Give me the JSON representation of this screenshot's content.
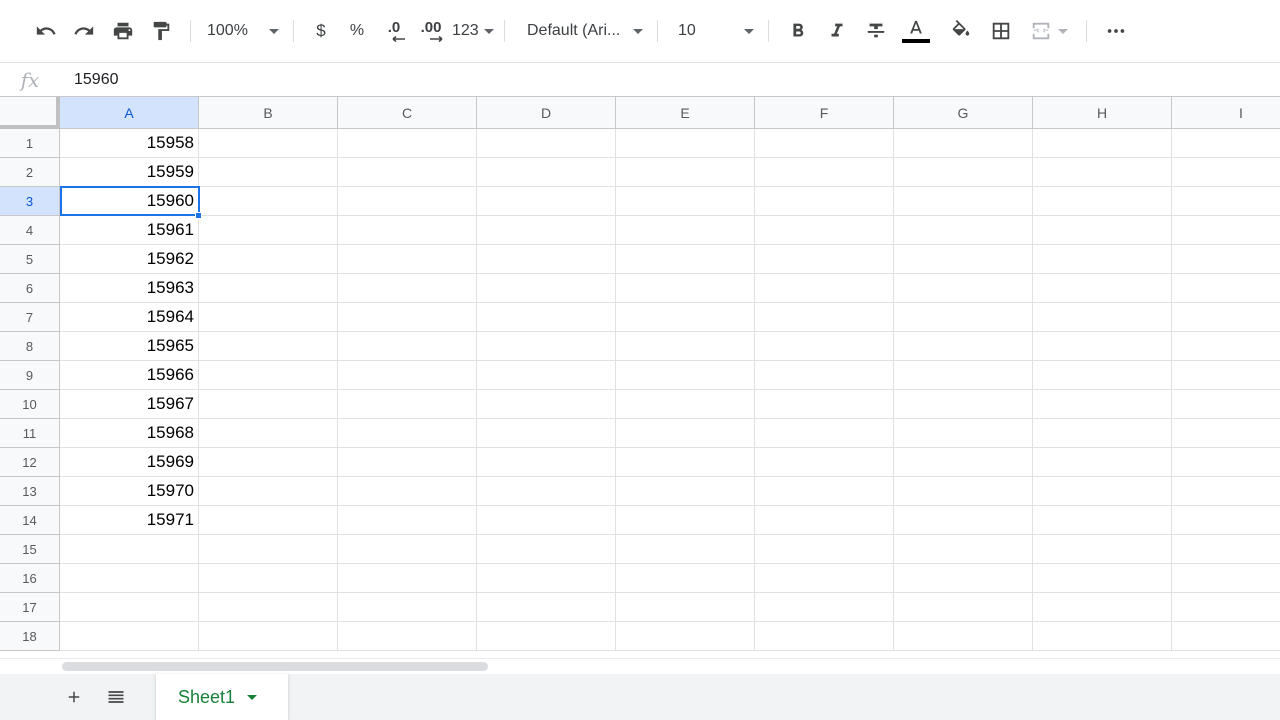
{
  "toolbar": {
    "zoom": "100%",
    "currency_label": "$",
    "percent_label": "%",
    "decrease_decimal_label": ".0",
    "increase_decimal_label": ".00",
    "more_formats_label": "123",
    "font_family": "Default (Ari...",
    "font_size": "10",
    "text_color": "#000000",
    "icons": [
      "undo-icon",
      "redo-icon",
      "print-icon",
      "paint-format-icon",
      "bold-icon",
      "italic-icon",
      "strikethrough-icon",
      "text-color-icon",
      "fill-color-icon",
      "borders-icon",
      "merge-cells-icon",
      "more-icon"
    ]
  },
  "formula_bar": {
    "fx_label": "fx",
    "value": "15960"
  },
  "grid": {
    "columns": [
      "A",
      "B",
      "C",
      "D",
      "E",
      "F",
      "G",
      "H",
      "I"
    ],
    "rows": [
      "1",
      "2",
      "3",
      "4",
      "5",
      "6",
      "7",
      "8",
      "9",
      "10",
      "11",
      "12",
      "13",
      "14",
      "15",
      "16",
      "17",
      "18"
    ],
    "column_a_values": [
      "15958",
      "15959",
      "15960",
      "15961",
      "15962",
      "15963",
      "15964",
      "15965",
      "15966",
      "15967",
      "15968",
      "15969",
      "15970",
      "15971"
    ],
    "selected_cell": "A3",
    "selection_color": "#1a73e8"
  },
  "sheets": {
    "tabs": [
      {
        "label": "Sheet1",
        "active": true
      }
    ],
    "accent_color": "#188038"
  }
}
